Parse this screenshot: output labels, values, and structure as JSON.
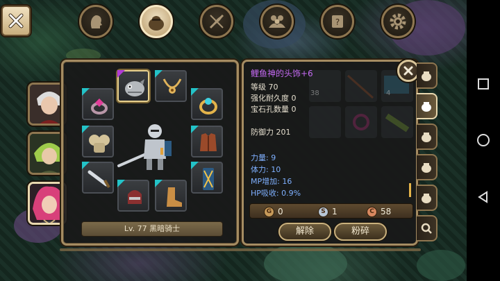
{
  "top_tabs": [
    {
      "id": "character",
      "icon": "head-silhouette-icon",
      "active": false
    },
    {
      "id": "inventory",
      "icon": "bag-icon",
      "active": true
    },
    {
      "id": "skills",
      "icon": "crossed-feather-icon",
      "active": false
    },
    {
      "id": "party",
      "icon": "group-icon",
      "active": false
    },
    {
      "id": "quests",
      "icon": "scroll-icon",
      "active": false
    },
    {
      "id": "settings",
      "icon": "gear-icon",
      "active": false
    }
  ],
  "portraits": [
    {
      "name": "white-haired-hero",
      "active": false
    },
    {
      "name": "green-haired-hero",
      "active": false
    },
    {
      "name": "pink-haired-hero",
      "active": true
    }
  ],
  "equipment": {
    "level_label": "Lv. 77 黑暗骑士",
    "selected_slot": "helmet"
  },
  "item": {
    "name": "鲤鱼神的头饰+6",
    "name_color": "#c46af2",
    "stats": [
      "等级 70",
      "强化耐久度 0",
      "宝石孔数量 0"
    ],
    "defense": "防御力 201",
    "bonuses": [
      "力量: 9",
      "体力: 10",
      "MP增加: 16",
      "HP吸收: 0.9%"
    ]
  },
  "currency": [
    {
      "icon": "bronze-coin-icon",
      "value": "0",
      "color": "#c79a5a"
    },
    {
      "icon": "silver-coin-icon",
      "value": "1",
      "color": "#b8c6d6"
    },
    {
      "icon": "copper-coin-icon",
      "value": "58",
      "color": "#d88860"
    }
  ],
  "actions": {
    "unequip": "解除",
    "destroy": "粉碎"
  },
  "bag_counts": [
    "38",
    "4"
  ]
}
